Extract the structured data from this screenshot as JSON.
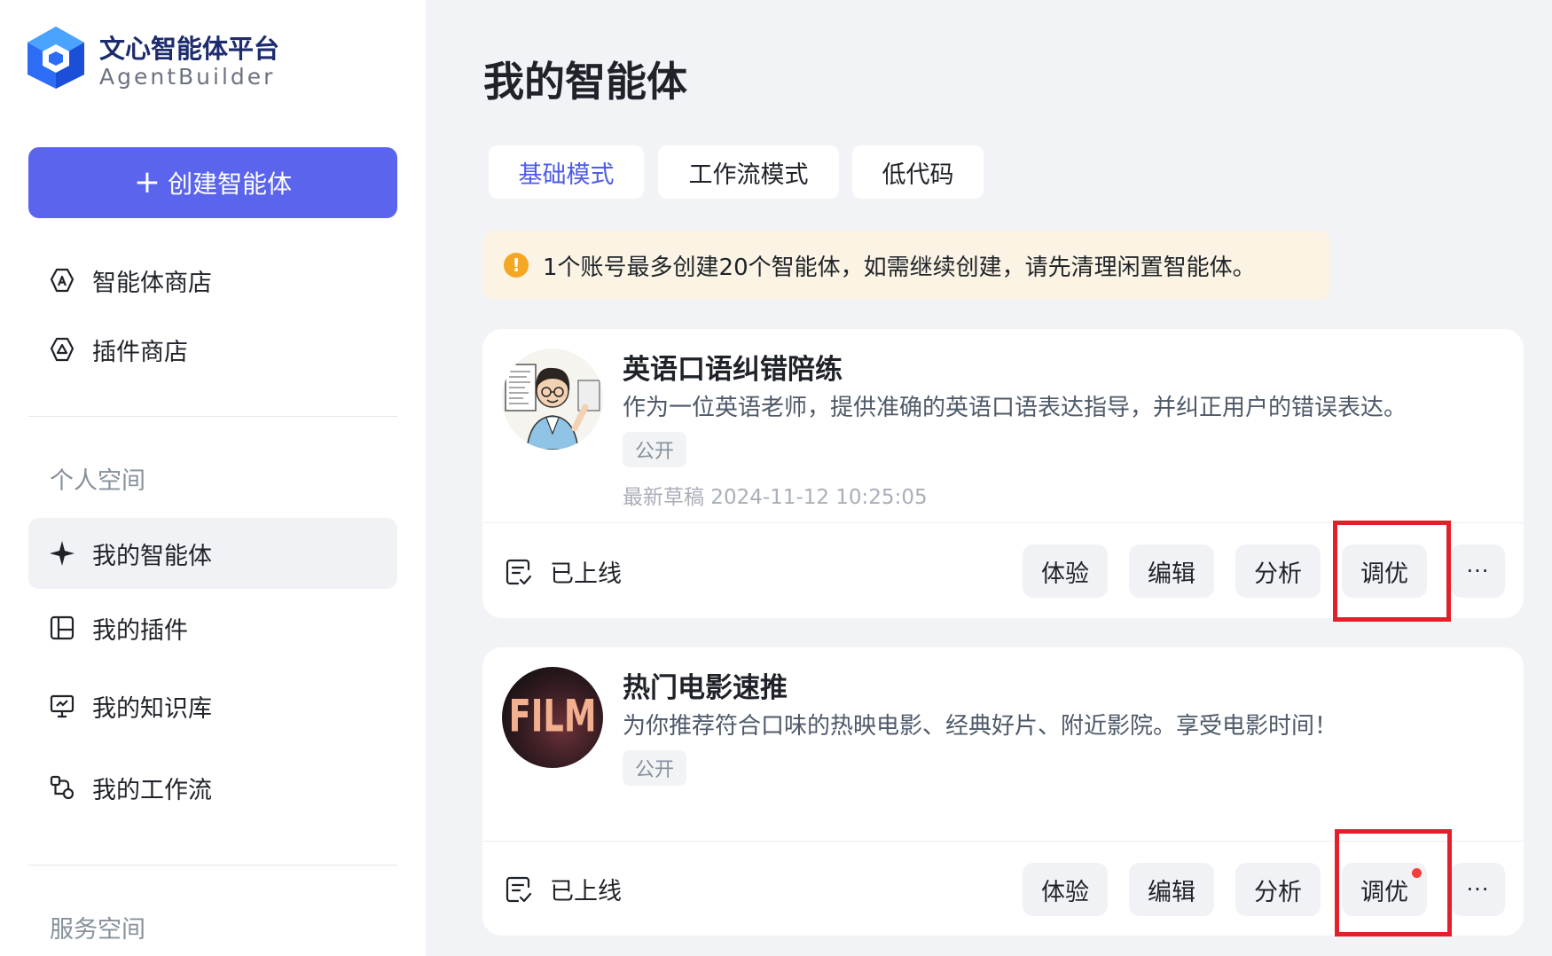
{
  "brand": {
    "title": "文心智能体平台",
    "subtitle": "AgentBuilder"
  },
  "sidebar": {
    "create_label": "创建智能体",
    "top_items": [
      {
        "label": "智能体商店",
        "icon": "store-icon"
      },
      {
        "label": "插件商店",
        "icon": "plugin-store-icon"
      }
    ],
    "personal_label": "个人空间",
    "personal_items": [
      {
        "label": "我的智能体",
        "icon": "sparkle-icon",
        "active": true
      },
      {
        "label": "我的插件",
        "icon": "plugin-icon"
      },
      {
        "label": "我的知识库",
        "icon": "monitor-icon"
      },
      {
        "label": "我的工作流",
        "icon": "workflow-icon"
      }
    ],
    "service_label": "服务空间"
  },
  "main": {
    "title": "我的智能体",
    "tabs": [
      {
        "label": "基础模式",
        "active": true
      },
      {
        "label": "工作流模式"
      },
      {
        "label": "低代码"
      }
    ],
    "notice": "1个账号最多创建20个智能体，如需继续创建，请先清理闲置智能体。",
    "agents": [
      {
        "name": "英语口语纠错陪练",
        "description": "作为一位英语老师，提供准确的英语口语表达指导，并纠正用户的错误表达。",
        "visibility": "公开",
        "draft": "最新草稿 2024-11-12 10:25:05",
        "status": "已上线",
        "actions": [
          "体验",
          "编辑",
          "分析",
          "调优"
        ],
        "more": "···",
        "avatar": "teacher-avatar"
      },
      {
        "name": "热门电影速推",
        "description": "为你推荐符合口味的热映电影、经典好片、附近影院。享受电影时间！",
        "visibility": "公开",
        "status": "已上线",
        "actions": [
          "体验",
          "编辑",
          "分析",
          "调优"
        ],
        "more": "···",
        "avatar": "film-avatar",
        "avatar_text": "FILM"
      }
    ]
  },
  "colors": {
    "primary": "#5a64ec",
    "tab_active": "#4e5de6",
    "highlight": "#e3202a",
    "notice_bg": "#fbf4e4",
    "warning": "#f5a623"
  }
}
